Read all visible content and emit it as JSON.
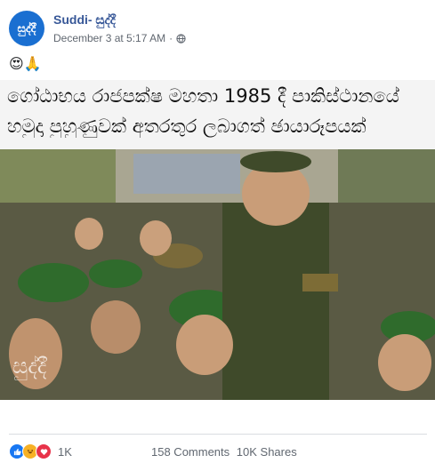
{
  "post": {
    "author": "Suddi- සුද්දී",
    "avatar_text": "සුද්දී",
    "date": "December 3 at 5:17 AM",
    "separator": "·",
    "privacy_icon": "globe-icon",
    "more_icon": "more-options-icon",
    "status_emojis": "😍🙏",
    "image": {
      "caption_line1": "ගෝඨාභය රාජපක්ෂ මහතා 1985 දී පාකිස්ථානයේ",
      "caption_line2": "හමුදා පුහුණුවක් අතරතුර ලබාගත් ඡායාරූපයක්",
      "watermark": "සුද්දී"
    }
  },
  "footer": {
    "reaction_icons": [
      "like-icon",
      "haha-icon",
      "love-icon"
    ],
    "reaction_count": "1K",
    "comments": "158 Comments",
    "shares": "10K Shares"
  },
  "colors": {
    "author_link": "#385898",
    "avatar_bg": "#1a6fd1",
    "muted_text": "#606770",
    "like": "#1877f2",
    "love": "#e8334a",
    "haha": "#f7b125",
    "uniform_green": "#3f4a2a",
    "beret_green": "#2f6b2c"
  }
}
